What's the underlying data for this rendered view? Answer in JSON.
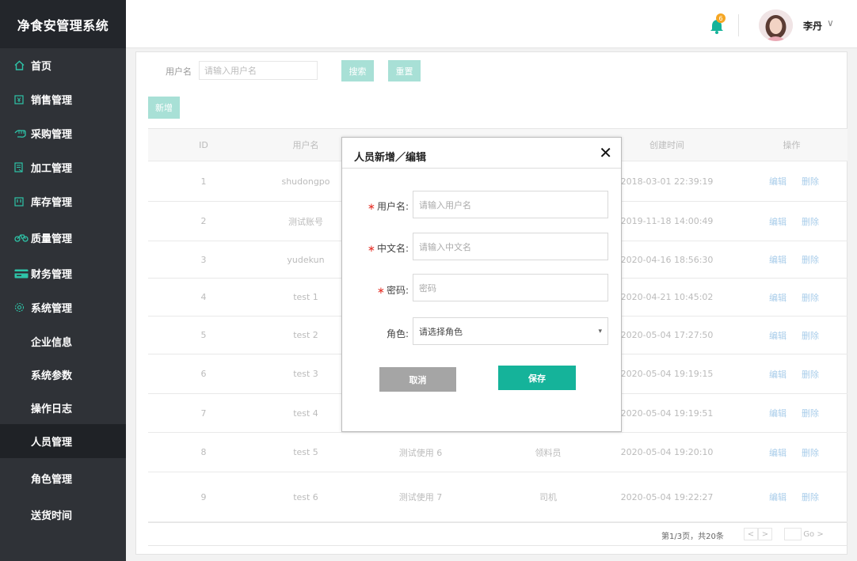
{
  "app": {
    "title": "净食安管理系统"
  },
  "sidebar": {
    "items": [
      {
        "label": "首页",
        "icon": "home-icon"
      },
      {
        "label": "销售管理",
        "icon": "sales-icon"
      },
      {
        "label": "采购管理",
        "icon": "hand-icon"
      },
      {
        "label": "加工管理",
        "icon": "process-icon"
      },
      {
        "label": "库存管理",
        "icon": "inventory-icon"
      },
      {
        "label": "质量管理",
        "icon": "bike-icon"
      },
      {
        "label": "财务管理",
        "icon": "card-icon"
      },
      {
        "label": "系统管理",
        "icon": "gear-icon"
      }
    ],
    "subitems": [
      {
        "label": "企业信息"
      },
      {
        "label": "系统参数"
      },
      {
        "label": "操作日志"
      },
      {
        "label": "人员管理",
        "active": true
      },
      {
        "label": "角色管理"
      },
      {
        "label": "送货时间"
      }
    ]
  },
  "header": {
    "notification_count": "6",
    "user_name": "李丹",
    "chevron": "∨"
  },
  "search": {
    "label": "用户名",
    "placeholder": "请输入用户名",
    "search_btn": "搜索",
    "reset_btn": "重置",
    "add_btn": "新增"
  },
  "table": {
    "columns": [
      "ID",
      "用户名",
      "",
      "",
      "创建时间",
      "操作"
    ],
    "edit_label": "编辑",
    "delete_label": "删除",
    "rows": [
      {
        "id": "1",
        "username": "shudongpo",
        "cname": "",
        "role": "",
        "created": "2018-03-01 22:39:19"
      },
      {
        "id": "2",
        "username": "测试账号",
        "cname": "",
        "role": "",
        "created": "2019-11-18 14:00:49"
      },
      {
        "id": "3",
        "username": "yudekun",
        "cname": "",
        "role": "",
        "created": "2020-04-16 18:56:30"
      },
      {
        "id": "4",
        "username": "test 1",
        "cname": "",
        "role": "",
        "created": "2020-04-21 10:45:02"
      },
      {
        "id": "5",
        "username": "test 2",
        "cname": "",
        "role": "",
        "created": "2020-05-04 17:27:50"
      },
      {
        "id": "6",
        "username": "test 3",
        "cname": "",
        "role": "",
        "created": "2020-05-04 19:19:15"
      },
      {
        "id": "7",
        "username": "test 4",
        "cname": "",
        "role": "",
        "created": "2020-05-04 19:19:51"
      },
      {
        "id": "8",
        "username": "test 5",
        "cname": "测试使用 6",
        "role": "领料员",
        "created": "2020-05-04 19:20:10"
      },
      {
        "id": "9",
        "username": "test 6",
        "cname": "测试使用 7",
        "role": "司机",
        "created": "2020-05-04 19:22:27"
      }
    ]
  },
  "pager": {
    "text": "第1/3页，共20条",
    "prev": "<",
    "next": ">",
    "go": "Go >"
  },
  "modal": {
    "title": "人员新增／编辑",
    "close": "✕",
    "fields": [
      {
        "label": "用户名:",
        "required": "∗",
        "placeholder": "请输入用户名"
      },
      {
        "label": "中文名:",
        "required": "∗",
        "placeholder": "请输入中文名"
      },
      {
        "label": "密码:",
        "required": "∗",
        "placeholder": "密码"
      },
      {
        "label": "角色:",
        "required": "",
        "placeholder": "请选择角色"
      }
    ],
    "select_arrow": "▾",
    "cancel_label": "取消",
    "save_label": "保存"
  },
  "colors": {
    "sidebar_bg": "#2f3237",
    "accent_teal": "#15b39a",
    "teal_light": "#a8e0d6",
    "cancel_gray": "#a5a5a5",
    "badge_orange": "#f5a623",
    "link_blue": "#a9cdea",
    "required_red": "#e5332a"
  }
}
